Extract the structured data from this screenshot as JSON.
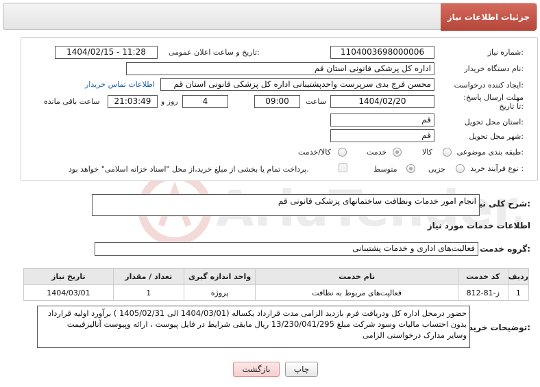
{
  "header": {
    "title": "جزئیات اطلاعات نیاز"
  },
  "fields": {
    "need_number_label": "شماره نیاز:",
    "need_number": "1104003698000006",
    "announce_label": "تاریخ و ساعت اعلان عمومی:",
    "announce_value": "1404/02/15 - 11:28",
    "buyer_org_label": "نام دستگاه خریدار:",
    "buyer_org": "اداره کل پزشکی قانونی استان قم",
    "creator_label": "ایجاد کننده درخواست:",
    "creator": "محسن فرج بدی سرپرست واحدپشتیبانی اداره کل پزشکی قانونی استان قم",
    "contact_link": "اطلاعات تماس خریدار",
    "deadline_label": "مهلت ارسال پاسخ: تا تاریخ:",
    "deadline_date": "1404/02/20",
    "time_label": "ساعت",
    "deadline_time": "09:00",
    "days_value": "4",
    "days_label": "روز و",
    "remaining_time": "21:03:49",
    "remaining_label": "ساعت باقی مانده",
    "province_label": "استان محل تحویل:",
    "province": "قم",
    "city_label": "شهر محل تحویل:",
    "city": "قم",
    "category_label": "طبقه بندی موضوعی:",
    "category_options": [
      "کالا",
      "خدمت",
      "کالا/خدمت"
    ],
    "category_selected": "خدمت",
    "process_label": "نوع فرآیند خرید :",
    "process_options": [
      "جزیی",
      "متوسط"
    ],
    "process_selected": "متوسط",
    "payment_note": "پرداخت تمام یا بخشی از مبلغ خرید،از محل \"اسناد خزانه اسلامی\" خواهد بود."
  },
  "summary": {
    "label": "شرح کلی نیاز:",
    "value": "انجام امور خدمات ونظافت ساختمانهای پزشکی قانونی قم"
  },
  "services": {
    "title": "اطلاعات خدمات مورد نیاز",
    "group_label": "گروه خدمت:",
    "group_value": "فعالیت‌های اداری و خدمات پشتیبانی",
    "columns": [
      "ردیف",
      "کد خدمت",
      "نام خدمت",
      "واحد اندازه گیری",
      "تعداد / مقدار",
      "تاریخ نیاز"
    ],
    "rows": [
      [
        "1",
        "ز-81-812",
        "فعالیت‌های مربوط به نظافت",
        "پروژه",
        "1",
        "1404/03/01"
      ]
    ]
  },
  "buyer_notes": {
    "label": "توضیحات خریدار:",
    "line1": "حضور درمحل اداره کل ودریافت فرم بازدید الزامی مدت قرارداد یکساله (1404/03/01 الی 1405/02/31 ) برآورد اولیه قرارداد",
    "line2": "بدون احتساب مالیات وسود شرکت مبلغ 13/230/041/295 ریال مابقی شرایط در فایل پیوست ، ارائه  وپیوست آنالیزقیمت",
    "line3": "وسایر مدارک درخواستی الزامی"
  },
  "buttons": {
    "print": "چاپ",
    "back": "بازگشت"
  },
  "watermark": {
    "text": "AriaTender.neT"
  },
  "colors": {
    "header_accent": "#c0564a",
    "link": "#1a5fb4"
  }
}
